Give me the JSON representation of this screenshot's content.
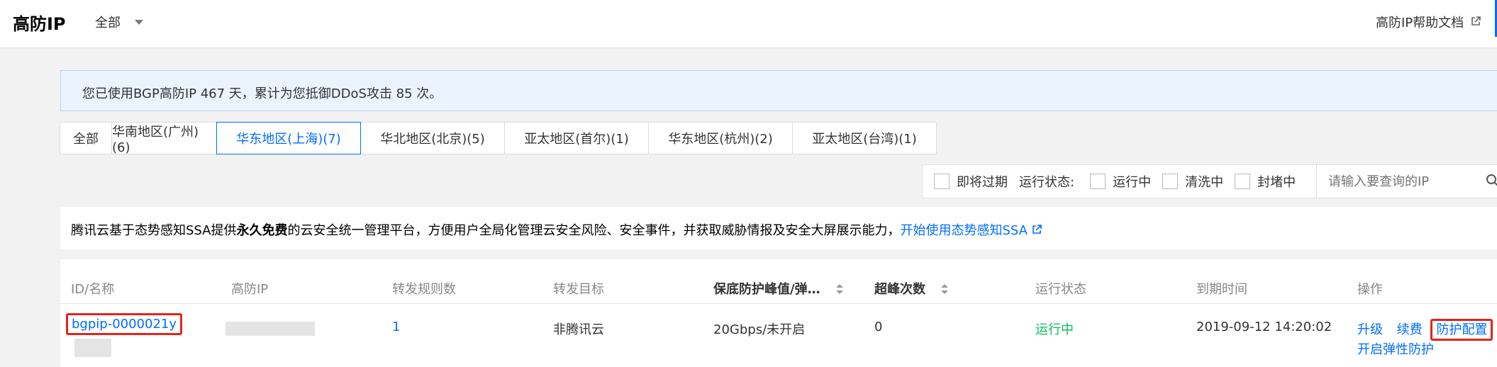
{
  "header": {
    "title": "高防IP",
    "scope": "全部",
    "help_link": "高防IP帮助文档"
  },
  "notice": {
    "text": "您已使用BGP高防IP 467 天，累计为您抵御DDoS攻击 85 次。"
  },
  "region_tabs": [
    {
      "label": "全部",
      "active": false
    },
    {
      "label": "华南地区(广州)(6)",
      "active": false
    },
    {
      "label": "华东地区(上海)(7)",
      "active": true
    },
    {
      "label": "华北地区(北京)(5)",
      "active": false
    },
    {
      "label": "亚太地区(首尔)(1)",
      "active": false
    },
    {
      "label": "华东地区(杭州)(2)",
      "active": false
    },
    {
      "label": "亚太地区(台湾)(1)",
      "active": false
    }
  ],
  "filters": {
    "expiring": "即将过期",
    "status_label": "运行状态:",
    "running": "运行中",
    "cleaning": "清洗中",
    "blocked": "封堵中",
    "search_placeholder": "请输入要查询的IP"
  },
  "ssa_banner": {
    "text_before": "腾讯云基于态势感知SSA提供",
    "text_bold": "永久免费",
    "text_after": "的云安全统一管理平台，方便用户全局化管理云安全风险、安全事件，并获取威胁情报及安全大屏展示能力，",
    "link": "开始使用态势感知SSA"
  },
  "table": {
    "columns": [
      "ID/名称",
      "高防IP",
      "转发规则数",
      "转发目标",
      "保底防护峰值/弹…",
      "超峰次数",
      "运行状态",
      "到期时间",
      "操作"
    ],
    "rows": [
      {
        "id": "bgpip-0000021y",
        "rules": "1",
        "target": "非腾讯云",
        "peak": "20Gbps/未开启",
        "exceed": "0",
        "status": "运行中",
        "expire": "2019-09-12 14:20:02",
        "actions": {
          "upgrade": "升级",
          "renew": "续费",
          "protect": "防护配置",
          "elastic": "开启弹性防护"
        }
      }
    ]
  },
  "colors": {
    "accent": "#006eff",
    "running": "#0abf5b",
    "highlight": "#e1251b"
  }
}
